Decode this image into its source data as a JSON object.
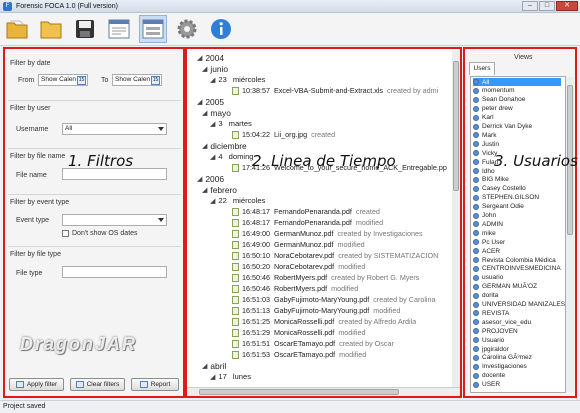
{
  "window": {
    "title": "Forensic FOCA 1.0 (Full version)",
    "app_icon": "foca-icon"
  },
  "window_controls": {
    "minimize": "–",
    "maximize": "□",
    "close": "✕"
  },
  "toolbar": {
    "icons": [
      "open-folder-icon",
      "folder-icon",
      "save-icon",
      "document-view-icon",
      "timeline-view-icon",
      "gear-icon",
      "info-icon"
    ],
    "active": "timeline-view-icon"
  },
  "filters": {
    "date": {
      "label": "Filter by date",
      "from_label": "From",
      "from_value": "Show Calen",
      "to_label": "To",
      "to_value": "Show Calen",
      "calendar_badge": "15"
    },
    "user": {
      "label": "Filter by user",
      "username_label": "Username",
      "username_value": "All"
    },
    "file_name": {
      "label": "Filter by file name",
      "field_label": "File name",
      "value": ""
    },
    "event_type": {
      "label": "Filter by event type",
      "field_label": "Event type",
      "value": "",
      "checkbox_label": "Don't show OS dates",
      "checked": false
    },
    "file_type": {
      "label": "Filter by file type",
      "field_label": "File type",
      "value": ""
    }
  },
  "buttons": {
    "apply": "Apply filter",
    "clear": "Clear filters",
    "report": "Report"
  },
  "annotations": {
    "filters": "1. Filtros",
    "timeline": "2. Linea de Tiempo",
    "users": "3. Usuarios"
  },
  "watermark": "DragonJAR",
  "timeline": [
    {
      "type": "year",
      "text": "2004"
    },
    {
      "type": "month",
      "text": "junio"
    },
    {
      "type": "day",
      "num": "23",
      "text": "miércoles"
    },
    {
      "type": "file",
      "time": "10:38:57",
      "name": "Excel-VBA-Submit-and-Extract.xls",
      "desc": "created by admi"
    },
    {
      "type": "year",
      "text": "2005"
    },
    {
      "type": "month",
      "text": "mayo"
    },
    {
      "type": "day",
      "num": "3",
      "text": "martes"
    },
    {
      "type": "file",
      "time": "15:04:22",
      "name": "Lii_org.jpg",
      "desc": "created"
    },
    {
      "type": "month",
      "text": "diciembre"
    },
    {
      "type": "day",
      "num": "4",
      "text": "doming"
    },
    {
      "type": "file",
      "time": "17:41:26",
      "name": "Welcome_to_your_secure_home_ACK_Entregable.pp",
      "desc": ""
    },
    {
      "type": "year",
      "text": "2006"
    },
    {
      "type": "month",
      "text": "febrero"
    },
    {
      "type": "day",
      "num": "22",
      "text": "miércoles"
    },
    {
      "type": "file",
      "time": "16:48:17",
      "name": "FernandoPenaranda.pdf",
      "desc": "created"
    },
    {
      "type": "file",
      "time": "16:48:17",
      "name": "FernandoPenaranda.pdf",
      "desc": "modified"
    },
    {
      "type": "file",
      "time": "16:49:00",
      "name": "GermanMunoz.pdf",
      "desc": "created by Investigaciones"
    },
    {
      "type": "file",
      "time": "16:49:00",
      "name": "GermanMunoz.pdf",
      "desc": "modified"
    },
    {
      "type": "file",
      "time": "16:50:10",
      "name": "NoraCebotarev.pdf",
      "desc": "created by SISTEMATIZACION"
    },
    {
      "type": "file",
      "time": "16:50:20",
      "name": "NoraCebotarev.pdf",
      "desc": "modified"
    },
    {
      "type": "file",
      "time": "16:50:46",
      "name": "RobertMyers.pdf",
      "desc": "created by Robert G. Myers"
    },
    {
      "type": "file",
      "time": "16:50:46",
      "name": "RobertMyers.pdf",
      "desc": "modified"
    },
    {
      "type": "file",
      "time": "16:51:03",
      "name": "GabyFujimoto-MaryYoung.pdf",
      "desc": "created by Carolina"
    },
    {
      "type": "file",
      "time": "16:51:13",
      "name": "GabyFujimoto-MaryYoung.pdf",
      "desc": "modified"
    },
    {
      "type": "file",
      "time": "16:51:25",
      "name": "MonicaRosselli.pdf",
      "desc": "created by Alfredo Ardila"
    },
    {
      "type": "file",
      "time": "16:51:29",
      "name": "MonicaRosselli.pdf",
      "desc": "modified"
    },
    {
      "type": "file",
      "time": "16:51:51",
      "name": "OscarETamayo.pdf",
      "desc": "created by Oscar"
    },
    {
      "type": "file",
      "time": "16:51:53",
      "name": "OscarETamayo.pdf",
      "desc": "modified"
    },
    {
      "type": "month",
      "text": "abril"
    },
    {
      "type": "day",
      "num": "17",
      "text": "lunes"
    }
  ],
  "views": {
    "label": "Views",
    "tab": "Users"
  },
  "users": [
    "All",
    "momentum",
    "Sean Donahoe",
    "peter drew",
    "Karl",
    "Derrick Van Dyke",
    "Mark",
    "Justin",
    "Vicky",
    "Fulan",
    "Idho",
    "BIG Mike",
    "Casey Costello",
    "STEPHEN.GILSON",
    "Sergeant Odie",
    "John",
    "ADMIN",
    "mike",
    "Pc User",
    "ACER",
    "Revista Colombia Médica",
    "CENTROINVESMEDICINA",
    "usuario",
    "GERMAN MUÃ'OZ",
    "dorita",
    "UNIVERSIDAD MANIZALES",
    "REVISTA",
    "asesor_vice_edu",
    "PROJOVEN",
    "Usuario",
    "jpgiraldor",
    "Carolina GÃ³mez",
    "Investigaciones",
    "docente",
    "USER"
  ],
  "status": "Project saved"
}
